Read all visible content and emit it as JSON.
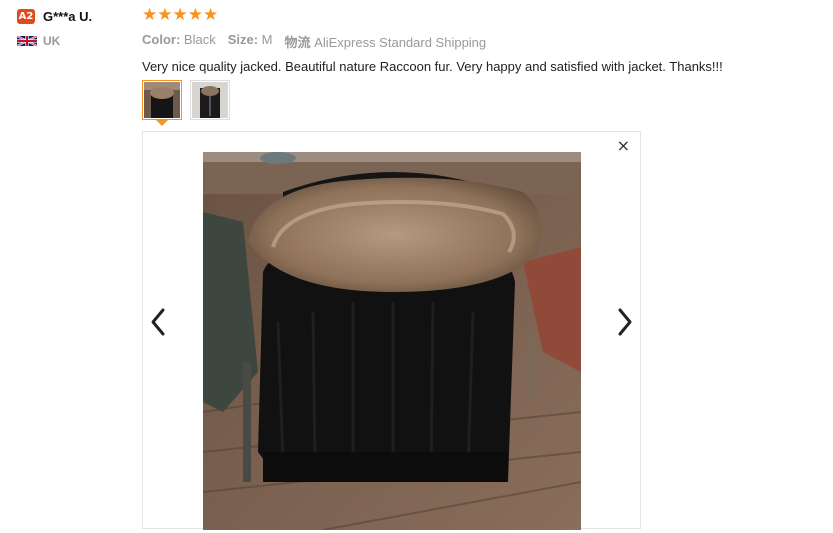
{
  "reviewer": {
    "badge": "A2",
    "name": "G***a U.",
    "country": "UK",
    "flag_icon": "uk-flag-icon"
  },
  "review": {
    "rating": 5,
    "stars": [
      "★",
      "★",
      "★",
      "★",
      "★"
    ],
    "color_label": "Color:",
    "color_value": "Black",
    "size_label": "Size:",
    "size_value": "M",
    "shipping_label": "物流",
    "shipping_value": "AliExpress Standard Shipping",
    "text": "Very nice quality jacked. Beautiful nature Raccoon fur. Very happy and satisfied with jacket. Thanks!!!"
  },
  "gallery": {
    "thumbnails": [
      "jacket-back-photo",
      "jacket-front-photo"
    ],
    "selected_index": 0,
    "close_glyph": "×",
    "prev_icon": "chevron-left-icon",
    "next_icon": "chevron-right-icon"
  },
  "colors": {
    "star": "#f7931e",
    "badge": "#e24a1d",
    "muted": "#999999"
  }
}
